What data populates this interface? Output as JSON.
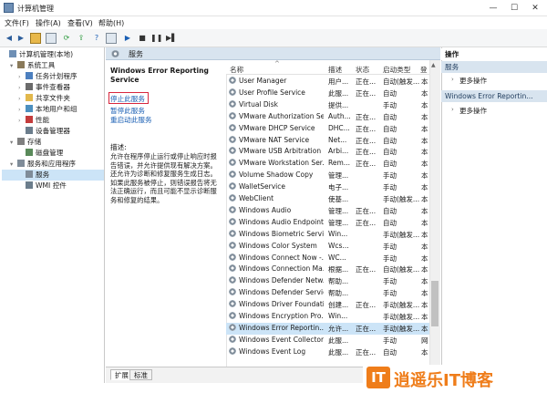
{
  "window": {
    "title": "计算机管理",
    "min": "—",
    "max": "☐",
    "close": "✕"
  },
  "menu": [
    "文件(F)",
    "操作(A)",
    "查看(V)",
    "帮助(H)"
  ],
  "tree": [
    {
      "label": "计算机管理(本地)",
      "arrow": "",
      "level": 0,
      "color": "#6e8fb5"
    },
    {
      "label": "系统工具",
      "arrow": "▾",
      "level": 1,
      "color": "#8a7a5a"
    },
    {
      "label": "任务计划程序",
      "arrow": "›",
      "level": 2,
      "color": "#4c7fbf"
    },
    {
      "label": "事件查看器",
      "arrow": "›",
      "level": 2,
      "color": "#6b6b6b"
    },
    {
      "label": "共享文件夹",
      "arrow": "›",
      "level": 2,
      "color": "#e2b84c"
    },
    {
      "label": "本地用户和组",
      "arrow": "›",
      "level": 2,
      "color": "#4c8fbf"
    },
    {
      "label": "性能",
      "arrow": "›",
      "level": 2,
      "color": "#c43c3c"
    },
    {
      "label": "设备管理器",
      "arrow": "",
      "level": 2,
      "color": "#6b7d8c"
    },
    {
      "label": "存储",
      "arrow": "▾",
      "level": 1,
      "color": "#7f7f7f"
    },
    {
      "label": "磁盘管理",
      "arrow": "",
      "level": 2,
      "color": "#5a8a5a"
    },
    {
      "label": "服务和应用程序",
      "arrow": "▾",
      "level": 1,
      "color": "#7f8c99"
    },
    {
      "label": "服务",
      "arrow": "",
      "level": 2,
      "color": "#7f8c99",
      "selected": true
    },
    {
      "label": "WMI 控件",
      "arrow": "",
      "level": 2,
      "color": "#6b7d8c"
    }
  ],
  "pane": {
    "header": "服务",
    "sort_arrow": "^"
  },
  "selected_service": {
    "title": "Windows Error Reporting Service",
    "stop": "停止此服务",
    "pause": "暂停此服务",
    "restart": "重启动此服务",
    "desc_label": "描述:",
    "description": "允许在程序停止运行或停止响应时报告错误，并允许提供现有解决方案。还允许为诊断和修复服务生成日志。如果此服务被停止，则错误报告将无法正确运行，而且可能不显示诊断服务和修复的结果。"
  },
  "columns": [
    "名称",
    "描述",
    "状态",
    "启动类型",
    "登"
  ],
  "services": [
    {
      "name": "User Manager",
      "desc": "用户...",
      "status": "正在...",
      "startup": "自动(触发...",
      "logon": "本"
    },
    {
      "name": "User Profile Service",
      "desc": "此服...",
      "status": "正在...",
      "startup": "自动",
      "logon": "本"
    },
    {
      "name": "Virtual Disk",
      "desc": "提供...",
      "status": "",
      "startup": "手动",
      "logon": "本"
    },
    {
      "name": "VMware Authorization Se...",
      "desc": "Auth...",
      "status": "正在...",
      "startup": "自动",
      "logon": "本"
    },
    {
      "name": "VMware DHCP Service",
      "desc": "DHC...",
      "status": "正在...",
      "startup": "自动",
      "logon": "本"
    },
    {
      "name": "VMware NAT Service",
      "desc": "Net...",
      "status": "正在...",
      "startup": "自动",
      "logon": "本"
    },
    {
      "name": "VMware USB Arbitration ...",
      "desc": "Arbi...",
      "status": "正在...",
      "startup": "自动",
      "logon": "本"
    },
    {
      "name": "VMware Workstation Ser...",
      "desc": "Rem...",
      "status": "正在...",
      "startup": "自动",
      "logon": "本"
    },
    {
      "name": "Volume Shadow Copy",
      "desc": "管理...",
      "status": "",
      "startup": "手动",
      "logon": "本"
    },
    {
      "name": "WalletService",
      "desc": "电子...",
      "status": "",
      "startup": "手动",
      "logon": "本"
    },
    {
      "name": "WebClient",
      "desc": "使基...",
      "status": "",
      "startup": "手动(触发...",
      "logon": "本"
    },
    {
      "name": "Windows Audio",
      "desc": "管理...",
      "status": "正在...",
      "startup": "自动",
      "logon": "本"
    },
    {
      "name": "Windows Audio Endpoint...",
      "desc": "管理...",
      "status": "正在...",
      "startup": "自动",
      "logon": "本"
    },
    {
      "name": "Windows Biometric Servi...",
      "desc": "Win...",
      "status": "",
      "startup": "手动(触发...",
      "logon": "本"
    },
    {
      "name": "Windows Color System",
      "desc": "Wcs...",
      "status": "",
      "startup": "手动",
      "logon": "本"
    },
    {
      "name": "Windows Connect Now -...",
      "desc": "WC...",
      "status": "",
      "startup": "手动",
      "logon": "本"
    },
    {
      "name": "Windows Connection Ma...",
      "desc": "根据...",
      "status": "正在...",
      "startup": "自动(触发...",
      "logon": "本"
    },
    {
      "name": "Windows Defender Netw...",
      "desc": "帮助...",
      "status": "",
      "startup": "手动",
      "logon": "本"
    },
    {
      "name": "Windows Defender Service",
      "desc": "帮助...",
      "status": "",
      "startup": "手动",
      "logon": "本"
    },
    {
      "name": "Windows Driver Foundati...",
      "desc": "创建...",
      "status": "正在...",
      "startup": "手动(触发...",
      "logon": "本"
    },
    {
      "name": "Windows Encryption Pro...",
      "desc": "Win...",
      "status": "",
      "startup": "手动(触发...",
      "logon": "本"
    },
    {
      "name": "Windows Error Reportin...",
      "desc": "允许...",
      "status": "正在...",
      "startup": "手动(触发...",
      "logon": "本",
      "selected": true
    },
    {
      "name": "Windows Event Collector",
      "desc": "此服...",
      "status": "",
      "startup": "手动",
      "logon": "网"
    },
    {
      "name": "Windows Event Log",
      "desc": "此服...",
      "status": "正在...",
      "startup": "自动",
      "logon": "本"
    }
  ],
  "tabs": [
    "扩展",
    "标准"
  ],
  "actions": {
    "header": "操作",
    "section1": "服务",
    "section1_more": "更多操作",
    "section2": "Windows Error Reportin...",
    "section2_more": "更多操作"
  },
  "watermark": {
    "mark": "IT",
    "text": "逍遥乐IT博客"
  },
  "colors": {
    "selection": "#cce4f7",
    "link": "#1a5fb4",
    "highlight_box": "#d7263d",
    "pane_header": "#d8e4ef",
    "brand": "#ef7d1a"
  }
}
